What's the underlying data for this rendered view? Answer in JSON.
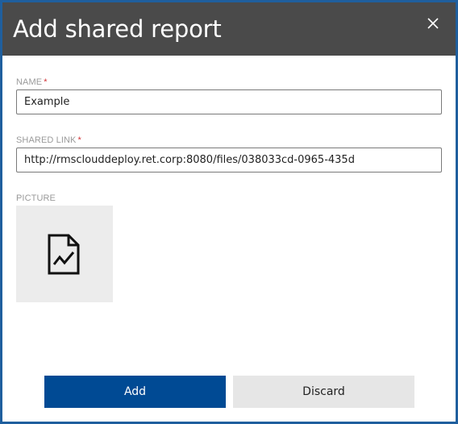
{
  "dialog": {
    "title": "Add shared report",
    "close_icon": "close-icon"
  },
  "form": {
    "name": {
      "label": "NAME",
      "required_marker": "*",
      "value": "Example"
    },
    "shared_link": {
      "label": "SHARED LINK",
      "required_marker": "*",
      "value": "http://rmsclouddeploy.ret.corp:8080/files/038033cd-0965-435d"
    },
    "picture": {
      "label": "PICTURE",
      "icon": "report-document-icon"
    }
  },
  "actions": {
    "add_label": "Add",
    "discard_label": "Discard"
  },
  "colors": {
    "header_bg": "#4a4a4a",
    "border": "#1f5f9e",
    "primary_button": "#004a94",
    "secondary_button": "#e6e6e6",
    "required": "#d13438"
  }
}
